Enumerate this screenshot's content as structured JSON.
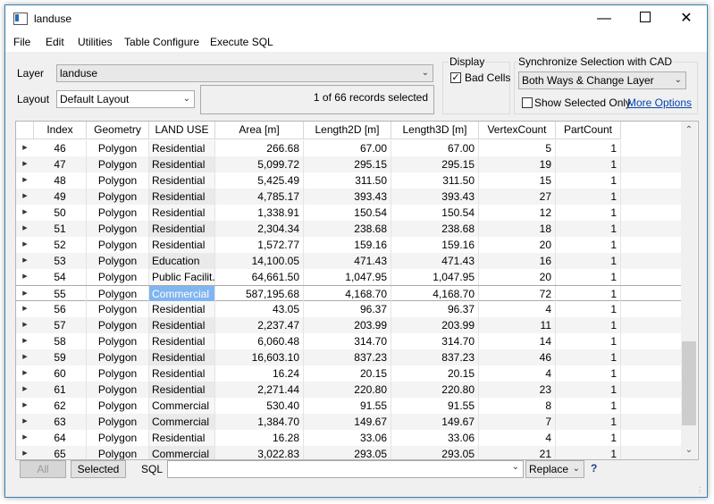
{
  "window": {
    "title": "landuse"
  },
  "menu": [
    "File",
    "Edit",
    "Utilities",
    "Table Configure",
    "Execute SQL"
  ],
  "layer": {
    "label": "Layer",
    "value": "landuse"
  },
  "layout": {
    "label": "Layout",
    "value": "Default Layout"
  },
  "records": {
    "text": "1 of 66 records selected"
  },
  "display": {
    "title": "Display",
    "bad_cells_label": "Bad Cells",
    "bad_cells_checked": true
  },
  "sync": {
    "title": "Synchronize Selection with CAD",
    "value": "Both Ways & Change Layer",
    "show_selected_label": "Show Selected Only",
    "more_options": "More Options"
  },
  "table": {
    "columns": [
      "Index",
      "Geometry",
      "LAND USE",
      "Area [m]",
      "Length2D [m]",
      "Length3D [m]",
      "VertexCount",
      "PartCount"
    ],
    "selected_index": "55",
    "rows": [
      [
        "46",
        "Polygon",
        "Residential",
        "266.68",
        "67.00",
        "67.00",
        "5",
        "1"
      ],
      [
        "47",
        "Polygon",
        "Residential",
        "5,099.72",
        "295.15",
        "295.15",
        "19",
        "1"
      ],
      [
        "48",
        "Polygon",
        "Residential",
        "5,425.49",
        "311.50",
        "311.50",
        "15",
        "1"
      ],
      [
        "49",
        "Polygon",
        "Residential",
        "4,785.17",
        "393.43",
        "393.43",
        "27",
        "1"
      ],
      [
        "50",
        "Polygon",
        "Residential",
        "1,338.91",
        "150.54",
        "150.54",
        "12",
        "1"
      ],
      [
        "51",
        "Polygon",
        "Residential",
        "2,304.34",
        "238.68",
        "238.68",
        "18",
        "1"
      ],
      [
        "52",
        "Polygon",
        "Residential",
        "1,572.77",
        "159.16",
        "159.16",
        "20",
        "1"
      ],
      [
        "53",
        "Polygon",
        "Education",
        "14,100.05",
        "471.43",
        "471.43",
        "16",
        "1"
      ],
      [
        "54",
        "Polygon",
        "Public Facilit...",
        "64,661.50",
        "1,047.95",
        "1,047.95",
        "20",
        "1"
      ],
      [
        "55",
        "Polygon",
        "Commercial",
        "587,195.68",
        "4,168.70",
        "4,168.70",
        "72",
        "1"
      ],
      [
        "56",
        "Polygon",
        "Residential",
        "43.05",
        "96.37",
        "96.37",
        "4",
        "1"
      ],
      [
        "57",
        "Polygon",
        "Residential",
        "2,237.47",
        "203.99",
        "203.99",
        "11",
        "1"
      ],
      [
        "58",
        "Polygon",
        "Residential",
        "6,060.48",
        "314.70",
        "314.70",
        "14",
        "1"
      ],
      [
        "59",
        "Polygon",
        "Residential",
        "16,603.10",
        "837.23",
        "837.23",
        "46",
        "1"
      ],
      [
        "60",
        "Polygon",
        "Residential",
        "16.24",
        "20.15",
        "20.15",
        "4",
        "1"
      ],
      [
        "61",
        "Polygon",
        "Residential",
        "2,271.44",
        "220.80",
        "220.80",
        "23",
        "1"
      ],
      [
        "62",
        "Polygon",
        "Commercial",
        "530.40",
        "91.55",
        "91.55",
        "8",
        "1"
      ],
      [
        "63",
        "Polygon",
        "Commercial",
        "1,384.70",
        "149.67",
        "149.67",
        "7",
        "1"
      ],
      [
        "64",
        "Polygon",
        "Residential",
        "16.28",
        "33.06",
        "33.06",
        "4",
        "1"
      ],
      [
        "65",
        "Polygon",
        "Commercial",
        "3,022.83",
        "293.05",
        "293.05",
        "21",
        "1"
      ]
    ]
  },
  "bottom": {
    "all_label": "All",
    "selected_label": "Selected",
    "sql_label": "SQL",
    "sql_value": "",
    "replace_value": "Replace",
    "help": "?"
  },
  "colors": {
    "selection": "#7fb5f0",
    "link": "#0645ad"
  }
}
